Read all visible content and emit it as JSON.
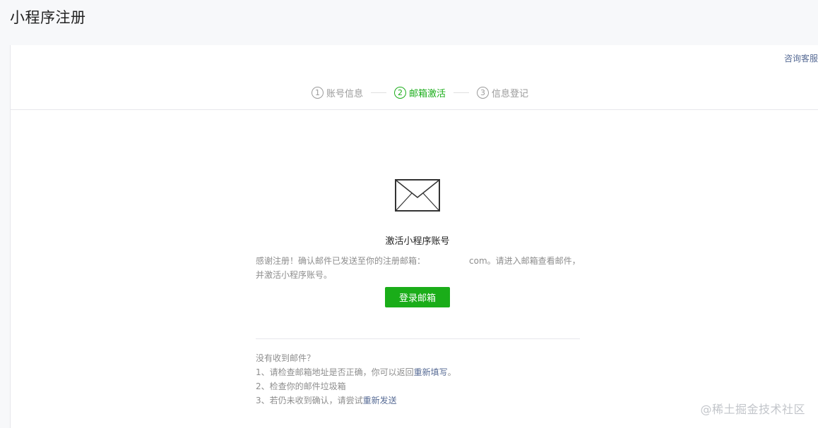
{
  "page": {
    "title": "小程序注册"
  },
  "header": {
    "consult_link": "咨询客服"
  },
  "steps": [
    {
      "num": "1",
      "label": "账号信息",
      "active": false
    },
    {
      "num": "2",
      "label": "邮箱激活",
      "active": true
    },
    {
      "num": "3",
      "label": "信息登记",
      "active": false
    }
  ],
  "main": {
    "icon": "envelope-icon",
    "title": "激活小程序账号",
    "desc_before": "感谢注册！确认邮件已发送至你的注册邮箱：",
    "desc_after": "com。请进入邮箱查看邮件，并激活小程序账号。",
    "login_button": "登录邮箱"
  },
  "help": {
    "question": "没有收到邮件？",
    "tip1_text": "1、请检查邮箱地址是否正确，你可以返回",
    "tip1_link": "重新填写",
    "tip1_end": "。",
    "tip2_text": "2、检查你的邮件垃圾箱",
    "tip3_text": "3、若仍未收到确认，请尝试",
    "tip3_link": "重新发送"
  },
  "watermark": "@稀土掘金技术社区",
  "colors": {
    "accent": "#1aad19",
    "link": "#576b95",
    "muted": "#8d8d8d"
  }
}
